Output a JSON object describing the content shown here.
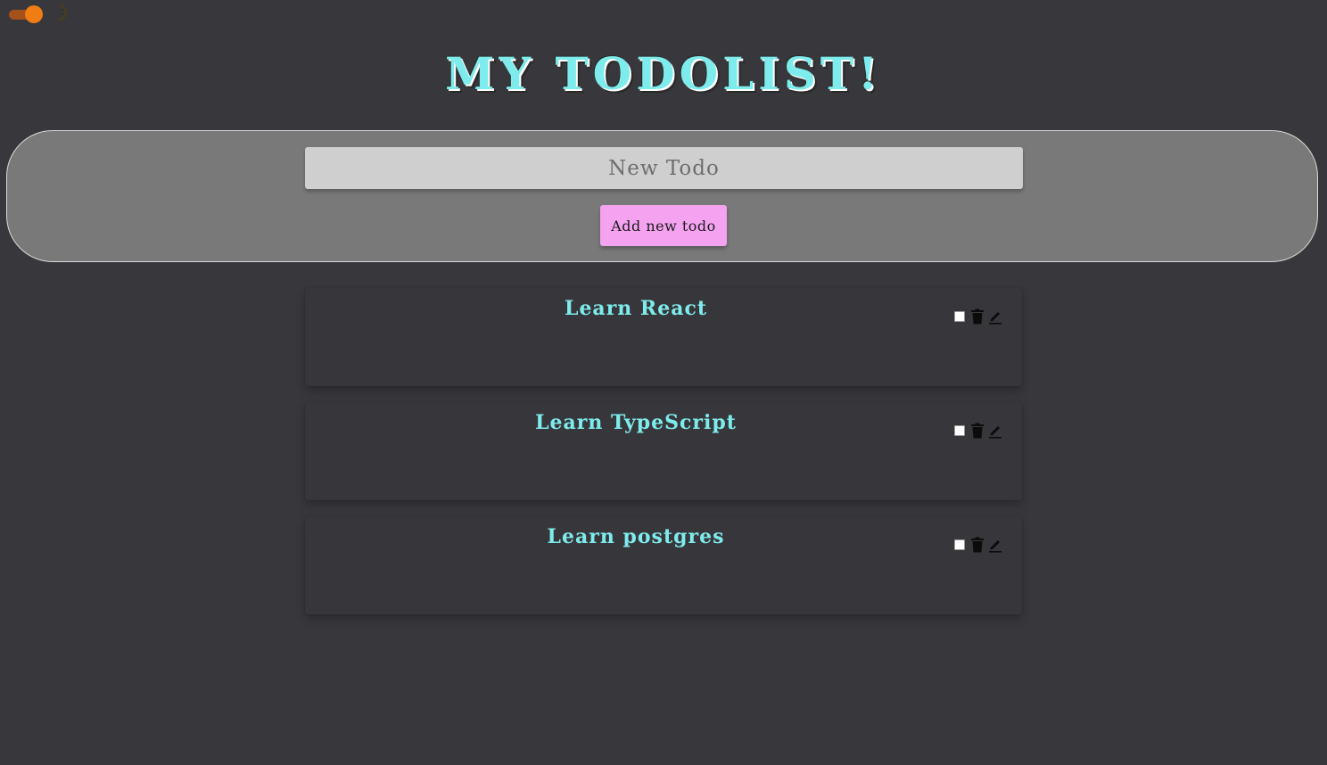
{
  "theme": {
    "toggle_on": true,
    "toggle_icon": "moon-icon",
    "colors": {
      "background": "#38383c",
      "accent_title": "#7eebec",
      "toggle_knob": "#f07c14",
      "add_button": "#f5a3f0"
    }
  },
  "header": {
    "title": "MY TODOLIST!"
  },
  "form": {
    "input_placeholder": "New Todo",
    "input_value": "",
    "add_button_label": "Add new todo"
  },
  "todos": [
    {
      "title": "Learn React",
      "completed": false,
      "actions": [
        "trash-icon",
        "pencil-icon"
      ]
    },
    {
      "title": "Learn TypeScript",
      "completed": false,
      "actions": [
        "trash-icon",
        "pencil-icon"
      ]
    },
    {
      "title": "Learn postgres",
      "completed": false,
      "actions": [
        "trash-icon",
        "pencil-icon"
      ]
    }
  ]
}
